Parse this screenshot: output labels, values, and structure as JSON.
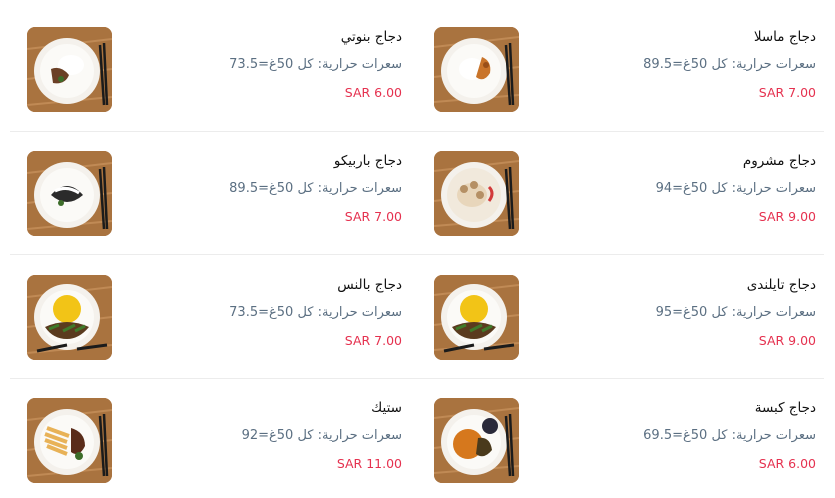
{
  "menu": {
    "items": [
      {
        "name": "دجاج ماسلا",
        "calories": "سعرات حرارية: كل 50غ=89.5",
        "price": "SAR 7.00",
        "image": "chicken-masala-rice-plate"
      },
      {
        "name": "دجاج بنوتي",
        "calories": "سعرات حرارية: كل 50غ=73.5",
        "price": "SAR 6.00",
        "image": "chicken-rice-plate"
      },
      {
        "name": "دجاج مشروم",
        "calories": "سعرات حرارية: كل 50غ=94",
        "price": "SAR 9.00",
        "image": "mushroom-chicken-plate"
      },
      {
        "name": "دجاج باربيكو",
        "calories": "سعرات حرارية: كل 50غ=89.5",
        "price": "SAR 7.00",
        "image": "bbq-chicken-plate"
      },
      {
        "name": "دجاج تايلندى",
        "calories": "سعرات حرارية: كل 50غ=95",
        "price": "SAR 9.00",
        "image": "thai-chicken-plate"
      },
      {
        "name": "دجاج بالنس",
        "calories": "سعرات حرارية: كل 50غ=73.5",
        "price": "SAR 7.00",
        "image": "chicken-rice-veg-plate"
      },
      {
        "name": "دجاج كبسة",
        "calories": "سعرات حرارية: كل 50غ=69.5",
        "price": "SAR 6.00",
        "image": "kabsa-chicken-plate"
      },
      {
        "name": "ستيك",
        "calories": "سعرات حرارية: كل 50غ=92",
        "price": "SAR 11.00",
        "image": "steak-fries-plate"
      }
    ]
  }
}
